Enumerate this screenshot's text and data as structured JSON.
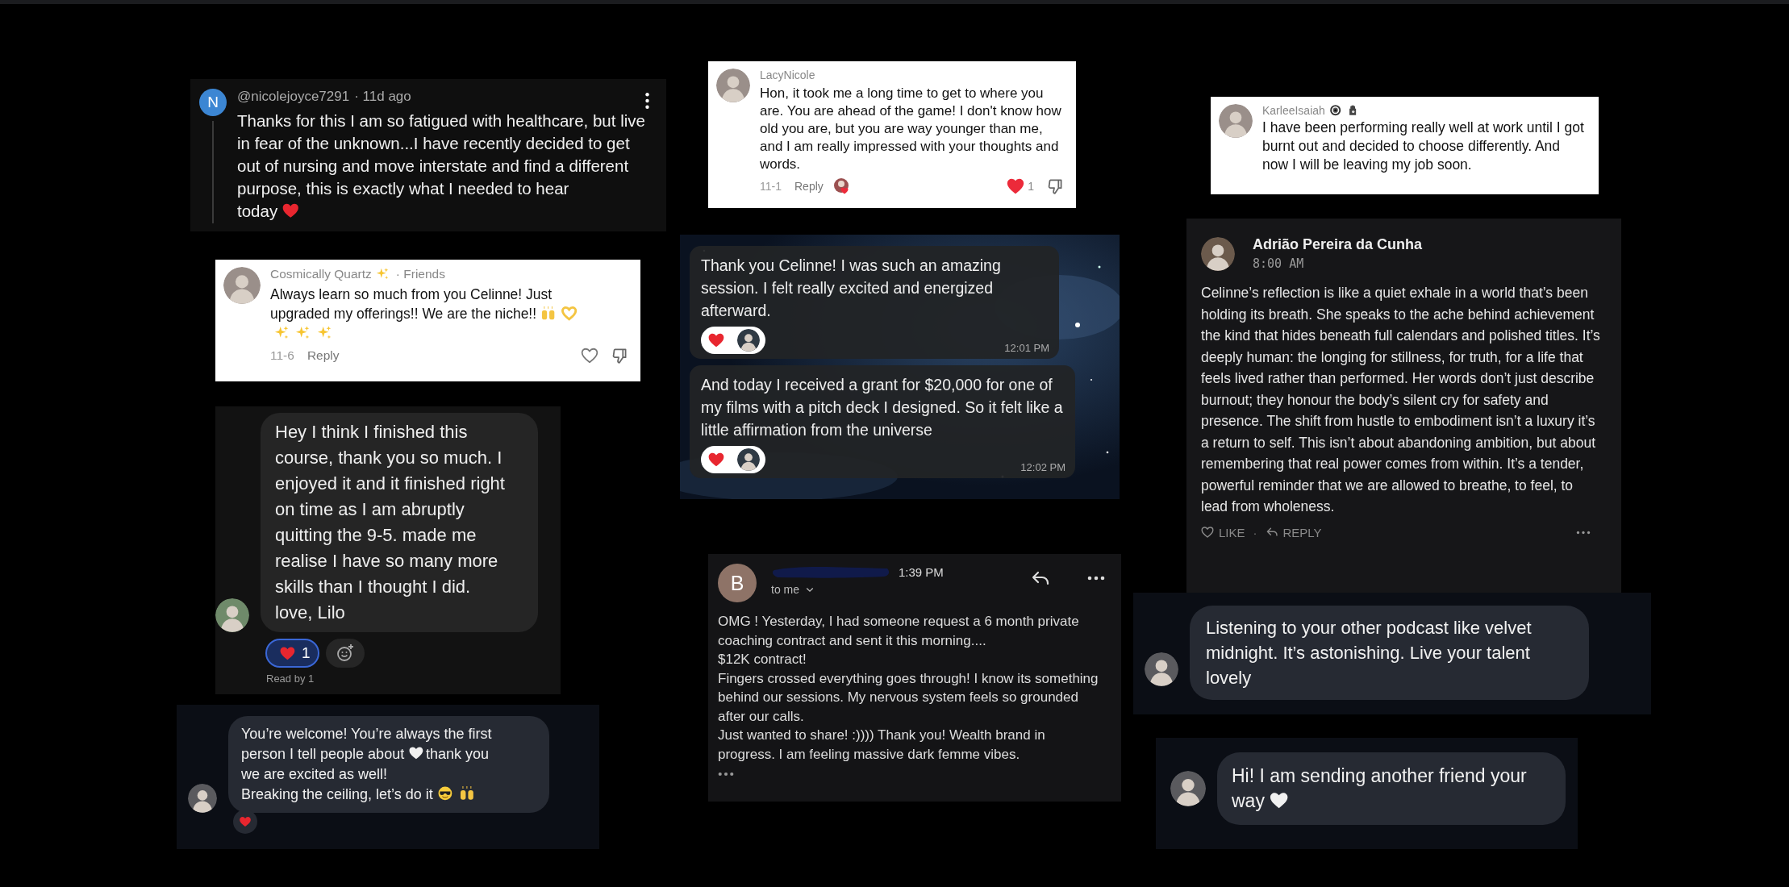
{
  "cards": [
    {
      "kind": "video-comment",
      "avatar_letter": "N",
      "author": "@nicolejoyce7291",
      "time": "· 11d ago",
      "body": [
        [
          {
            "kind": "text",
            "text": "Thanks for this I am so fatigued with healthcare, but live in fear of the unknown...I have recently decided to get out of nursing and move interstate and find a different purpose, this is exactly what I needed to hear"
          }
        ],
        [
          {
            "kind": "text",
            "text": "today"
          },
          {
            "kind": "red-heart"
          }
        ]
      ]
    },
    {
      "kind": "light-comment",
      "author": [
        {
          "kind": "text",
          "text": "Cosmically Quartz"
        },
        {
          "kind": "sparkles"
        }
      ],
      "context": "· Friends",
      "body": [
        [
          {
            "kind": "text",
            "text": "Always learn so much from you Celinne! Just"
          }
        ],
        [
          {
            "kind": "text",
            "text": "upgraded my offerings!! We are the niche!!"
          },
          {
            "kind": "raised-hands"
          },
          {
            "kind": "heart-hands"
          }
        ],
        [
          {
            "kind": "sparkles"
          },
          {
            "kind": "sparkles"
          },
          {
            "kind": "sparkles"
          }
        ]
      ],
      "date": "11-6",
      "reply": "Reply",
      "liked": false,
      "creator_liked": false
    },
    {
      "kind": "chat-incoming",
      "body": "Hey I think I finished this course, thank you so much. I enjoyed it and it finished right on time as I am abruptly quitting the 9-5. made me realise I have so many more skills than I thought I did.\nlove, Lilo",
      "reaction_count": "1",
      "reaction_selected": true,
      "read": "Read by 1"
    },
    {
      "kind": "dm",
      "body": [
        [
          {
            "kind": "text",
            "text": "You’re welcome! You’re always the first"
          }
        ],
        [
          {
            "kind": "text",
            "text": "person I tell people about"
          },
          {
            "kind": "white-heart"
          },
          {
            "kind": "text",
            "text": "thank you"
          }
        ],
        [
          {
            "kind": "text",
            "text": "we are excited as well!"
          }
        ],
        [
          {
            "kind": "text",
            "text": "Breaking the ceiling, let’s do it"
          },
          {
            "kind": "sunglasses"
          },
          {
            "kind": "raised-hands"
          }
        ]
      ],
      "reacted": true
    },
    {
      "kind": "light-comment",
      "author": "LacyNicole",
      "body": "Hon, it took me a long time to get to where you are. You are ahead of the game! I don't know how old you are, but you are way younger than me, and I am really impressed with your thoughts and words.",
      "date": "11-1",
      "reply": "Reply",
      "liked": true,
      "likes": "1",
      "creator_liked": true
    },
    {
      "kind": "sms-thread",
      "messages": [
        {
          "body": "Thank you Celinne! I was such an amazing session. I felt really excited and energized afterward.",
          "time": "12:01 PM"
        },
        {
          "body": "And today I received a grant for $20,000 for one of my films with a pitch deck I designed. So it felt like a little affirmation from the universe",
          "time": "12:02 PM"
        }
      ]
    },
    {
      "kind": "email",
      "avatar_letter": "B",
      "time": "1:39 PM",
      "recipient": "to me",
      "body": "OMG ! Yesterday, I had someone request a 6 month private coaching contract and sent it this morning....\n$12K contract!\nFingers crossed everything goes through! I know its something behind our sessions. My nervous system feels so grounded after our calls.\nJust wanted to share! :)))) Thank you! Wealth brand in progress. I am feeling massive dark femme vibes."
    },
    {
      "kind": "light-comment",
      "author": [
        {
          "kind": "text",
          "text": "KarleeIsaiah"
        },
        {
          "kind": "nazar"
        },
        {
          "kind": "hamsa"
        }
      ],
      "body": "I have been performing really well at work until I got burnt out and decided to choose differently. And now I will be leaving my job soon."
    },
    {
      "kind": "forum-post",
      "author": "Adrião Pereira da Cunha",
      "time": "8:00 AM",
      "body": "Celinne’s reflection is like a quiet exhale in a world that’s been holding its breath. She speaks to the ache behind achievement the kind that hides beneath full calendars and polished titles. It’s deeply human: the longing for stillness, for truth, for a life that feels lived rather than performed. Her words don’t just describe burnout; they honour the body’s silent cry for safety and presence. The shift from hustle to embodiment isn’t a luxury it’s a return to self. This isn’t about abandoning ambition, but about remembering that real power comes from within. It’s a tender, powerful reminder that we are allowed to breathe, to feel, to lead from wholeness.",
      "like": "LIKE",
      "separator": "·",
      "reply": "REPLY"
    },
    {
      "kind": "dm",
      "body": "Listening to your other podcast like velvet midnight. It’s astonishing. Live your talent lovely",
      "reacted": false
    },
    {
      "kind": "dm",
      "body": [
        [
          {
            "kind": "text",
            "text": "Hi! I am sending another friend your"
          }
        ],
        [
          {
            "kind": "text",
            "text": "way"
          },
          {
            "kind": "white-heart"
          }
        ]
      ],
      "reacted": false
    }
  ]
}
